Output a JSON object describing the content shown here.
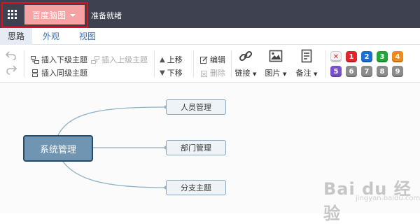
{
  "titlebar": {
    "doc_name": "百度脑图",
    "status": "准备就绪"
  },
  "tabs": [
    {
      "label": "思路",
      "active": true
    },
    {
      "label": "外观",
      "active": false
    },
    {
      "label": "视图",
      "active": false
    }
  ],
  "toolbar": {
    "insert_child": "插入下级主题",
    "insert_parent": "插入上级主题",
    "insert_sibling": "插入同级主题",
    "move_up": "上移",
    "move_down": "下移",
    "edit": "编辑",
    "delete": "删除",
    "link": "链接",
    "image": "图片",
    "note": "备注",
    "priorities": [
      "✕",
      "1",
      "2",
      "3",
      "4",
      "5",
      "6",
      "7",
      "8",
      "9"
    ]
  },
  "mindmap": {
    "root": "系统管理",
    "children": [
      "人员管理",
      "部门管理",
      "分支主题"
    ]
  },
  "watermark": {
    "logo": "Bai du 经验",
    "url": "jingyan.baidu.com"
  },
  "colors": {
    "titlebar": "#3e4250",
    "doc_name_bg": "#f5a3a2",
    "highlight": "#e0111d",
    "root_fill": "#6f95b3",
    "root_border": "#234c6c",
    "line": "#8fb0c6",
    "priority_colors": [
      "#f3f3f3",
      "#e0262c",
      "#1a6fd6",
      "#22a536",
      "#f08a1c",
      "#7b4fd0",
      "#8c8c8c",
      "#8c8c8c",
      "#8c8c8c",
      "#8c8c8c"
    ]
  }
}
